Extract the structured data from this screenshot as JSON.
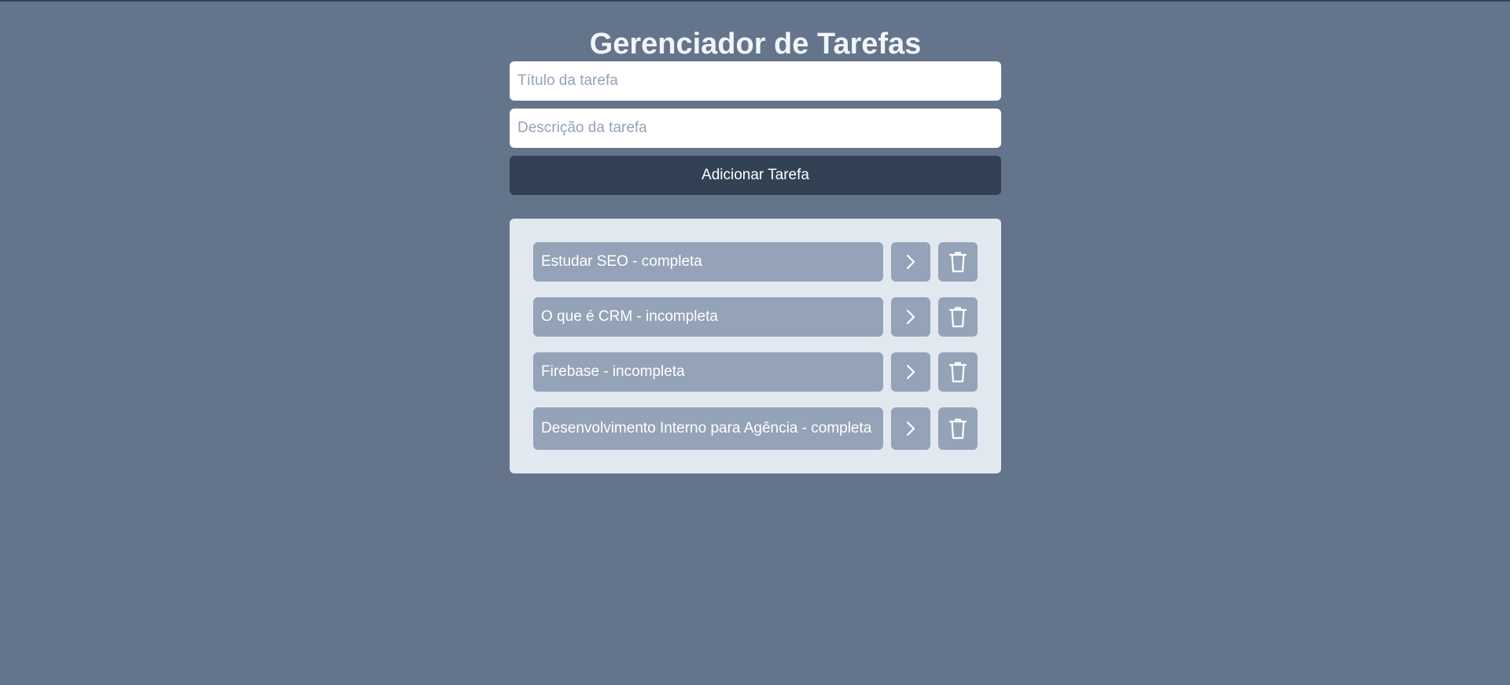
{
  "app": {
    "title": "Gerenciador de Tarefas"
  },
  "form": {
    "title_placeholder": "Título da tarefa",
    "title_value": "",
    "description_placeholder": "Descrição da tarefa",
    "description_value": "",
    "add_button_label": "Adicionar Tarefa"
  },
  "tasks": [
    {
      "label": "Estudar SEO - completa",
      "detail_icon": "chevron-right-icon",
      "delete_icon": "trash-icon"
    },
    {
      "label": "O que é CRM - incompleta",
      "detail_icon": "chevron-right-icon",
      "delete_icon": "trash-icon"
    },
    {
      "label": "Firebase - incompleta",
      "detail_icon": "chevron-right-icon",
      "delete_icon": "trash-icon"
    },
    {
      "label": "Desenvolvimento Interno para Agência - completa",
      "detail_icon": "chevron-right-icon",
      "delete_icon": "trash-icon"
    }
  ],
  "colors": {
    "background": "#64748b",
    "button_dark": "#334155",
    "list_panel": "#e2e8f0",
    "task_item": "#94a3b8",
    "text_light": "#ffffff"
  }
}
